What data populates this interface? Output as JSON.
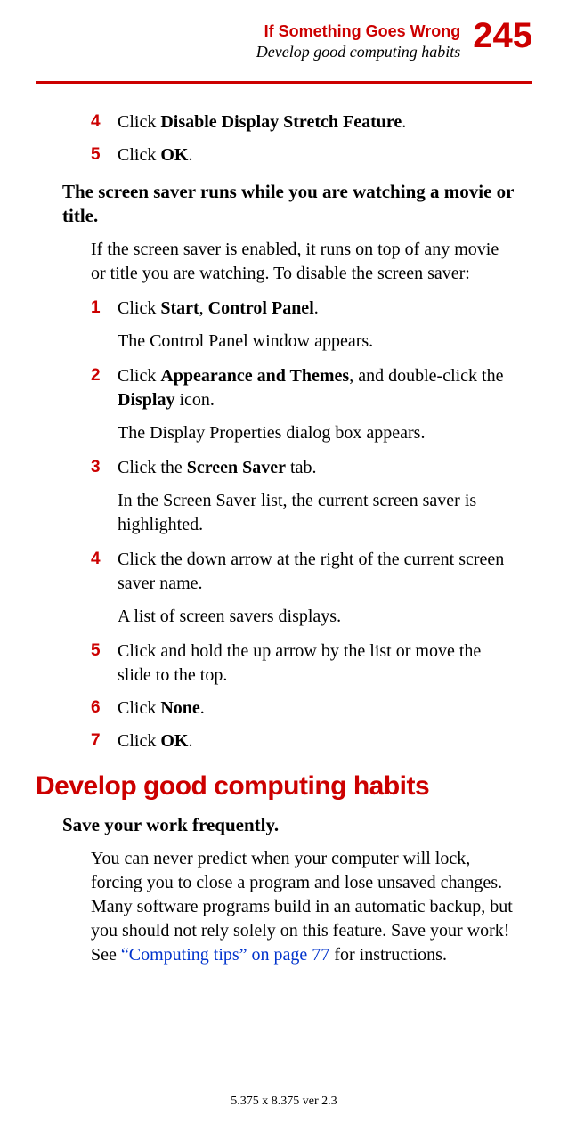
{
  "header": {
    "chapter": "If Something Goes Wrong",
    "section": "Develop good computing habits",
    "page_number": "245"
  },
  "steps_top": [
    {
      "num": "4",
      "pre": "Click ",
      "bold": "Disable Display Stretch Feature",
      "post": "."
    },
    {
      "num": "5",
      "pre": "Click ",
      "bold": "OK",
      "post": "."
    }
  ],
  "problem1": {
    "heading": "The screen saver runs while you are watching a movie or title.",
    "intro": "If the screen saver is enabled, it runs on top of any movie or title you are watching. To disable the screen saver:"
  },
  "steps_main": {
    "s1": {
      "num": "1",
      "pre": "Click ",
      "b1": "Start",
      "mid": ", ",
      "b2": "Control Panel",
      "post": ".",
      "sub": "The Control Panel window appears."
    },
    "s2": {
      "num": "2",
      "pre": "Click ",
      "b1": "Appearance and Themes",
      "mid": ", and double-click the ",
      "b2": "Display",
      "post": " icon.",
      "sub": "The Display Properties dialog box appears."
    },
    "s3": {
      "num": "3",
      "pre": "Click the ",
      "b1": "Screen Saver",
      "post": " tab.",
      "sub": "In the Screen Saver list, the current screen saver is highlighted."
    },
    "s4": {
      "num": "4",
      "text": "Click the down arrow at the right of the current screen saver name.",
      "sub": "A list of screen savers displays."
    },
    "s5": {
      "num": "5",
      "text": "Click and hold the up arrow by the list or move the slide to the top."
    },
    "s6": {
      "num": "6",
      "pre": "Click ",
      "b1": "None",
      "post": "."
    },
    "s7": {
      "num": "7",
      "pre": "Click ",
      "b1": "OK",
      "post": "."
    }
  },
  "section2": {
    "heading": "Develop good computing habits",
    "sub_heading": "Save your work frequently.",
    "para_pre": "You can never predict when your computer will lock, forcing you to close a program and lose unsaved changes. Many software programs build in an automatic backup, but you should not rely solely on this feature. Save your work! See ",
    "link": "“Computing tips” on page 77",
    "para_post": " for instructions."
  },
  "footer": "5.375 x 8.375 ver 2.3"
}
